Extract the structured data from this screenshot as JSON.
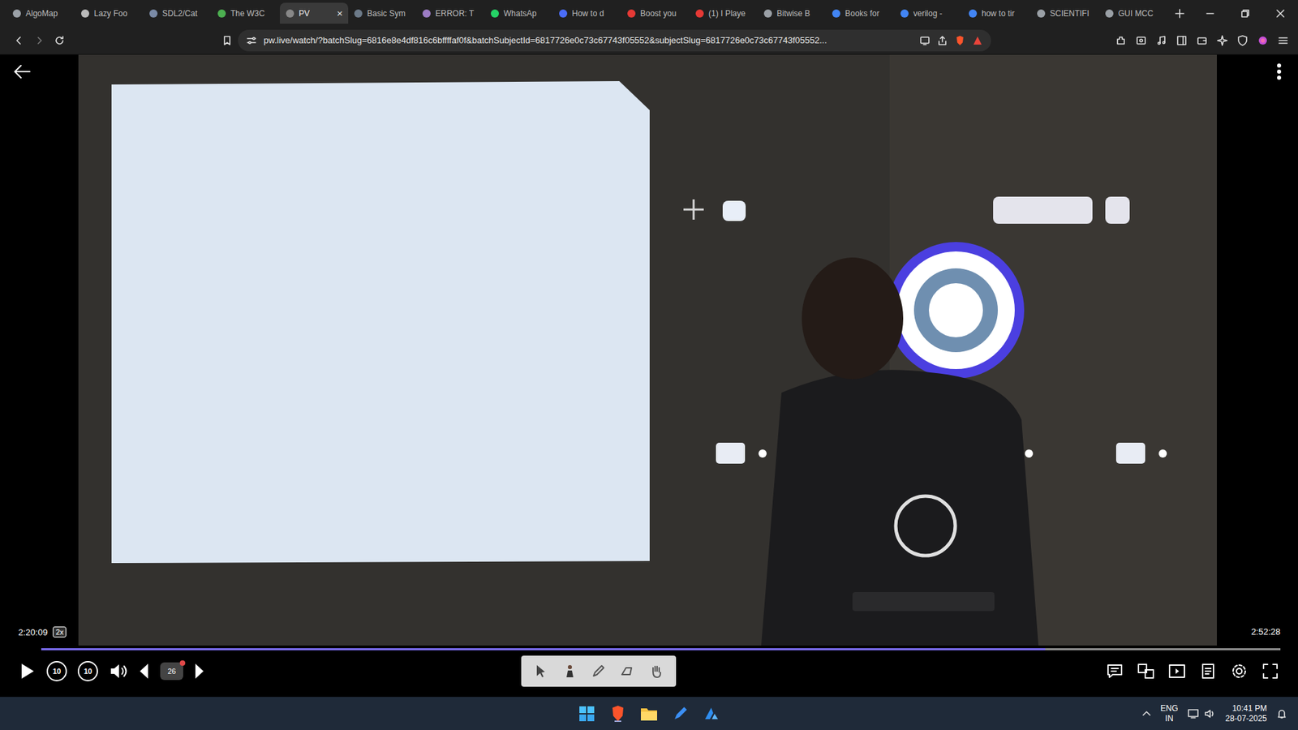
{
  "browser": {
    "tabs": [
      {
        "label": "AlgoMap",
        "selected": false
      },
      {
        "label": "Lazy Foo",
        "selected": false
      },
      {
        "label": "SDL2/Cat",
        "selected": false
      },
      {
        "label": "The W3C",
        "selected": false
      },
      {
        "label": "PV",
        "selected": true,
        "close": "×"
      },
      {
        "label": "Basic Sym",
        "selected": false
      },
      {
        "label": "ERROR: T",
        "selected": false
      },
      {
        "label": "WhatsAp",
        "selected": false
      },
      {
        "label": "How to d",
        "selected": false
      },
      {
        "label": "Boost you",
        "selected": false
      },
      {
        "label": "(1) I Playe",
        "selected": false
      },
      {
        "label": "Bitwise B",
        "selected": false
      },
      {
        "label": "Books for",
        "selected": false
      },
      {
        "label": "verilog -",
        "selected": false
      },
      {
        "label": "how to tir",
        "selected": false
      },
      {
        "label": "SCIENTIFI",
        "selected": false
      },
      {
        "label": "GUI MCC",
        "selected": false
      }
    ],
    "url": "pw.live/watch/?batchSlug=6816e8e4df816c6bffffaf0f&batchSubjectId=6817726e0c73c67743f05552&subjectSlug=6817726e0c73c67743f05552..."
  },
  "player": {
    "elapsed": "2:20:09",
    "speed": "2x",
    "duration": "2:52:28",
    "progress": {
      "level": 0.81
    },
    "playing": false,
    "skip_back": "10",
    "skip_forward": "10",
    "slide": "26"
  },
  "taskbar": {
    "language": "ENG",
    "region": "IN",
    "time": "10:41 PM",
    "date": "28-07-2025"
  }
}
